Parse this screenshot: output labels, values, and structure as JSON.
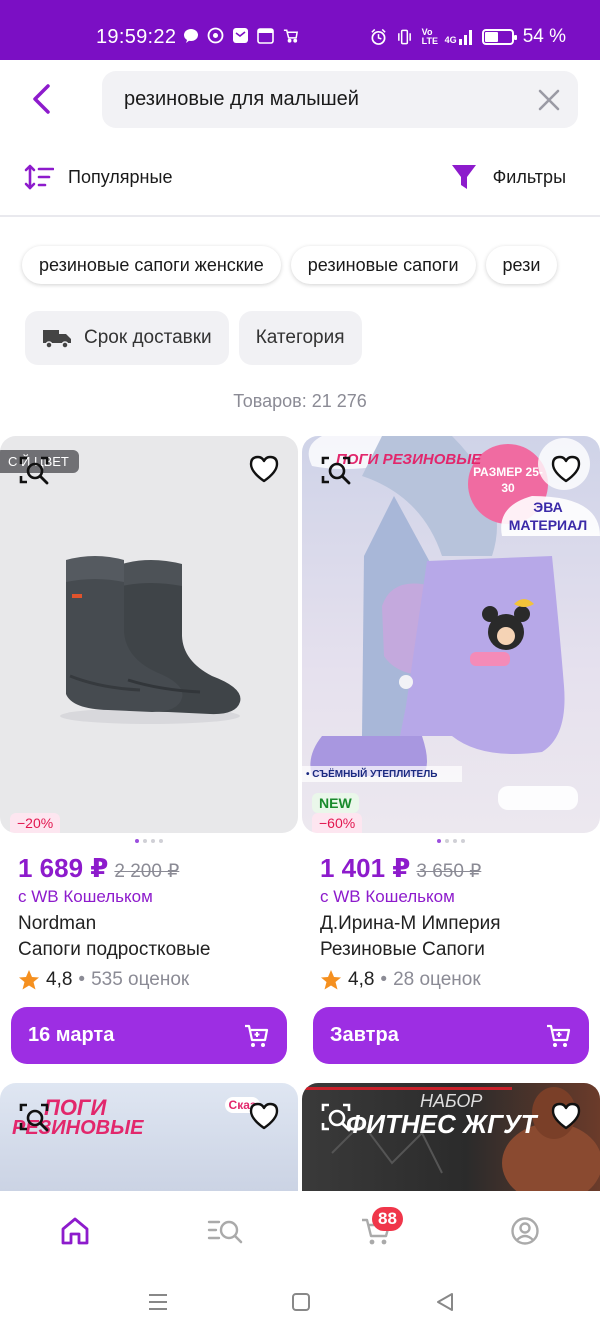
{
  "status_bar": {
    "time": "19:59:22",
    "battery_percent": "54 %",
    "battery_level": 0.54,
    "volte_label": "Vo LTE",
    "network_label": "4G",
    "bg_color": "#7b0fc4"
  },
  "search": {
    "query": "резиновые для малышей"
  },
  "sort": {
    "label": "Популярные"
  },
  "filters_button": {
    "label": "Фильтры"
  },
  "chips": [
    {
      "label": "резиновые сапоги женские"
    },
    {
      "label": "резиновые сапоги"
    },
    {
      "label": "рези"
    }
  ],
  "filter_buttons": {
    "delivery": "Срок доставки",
    "category": "Категория"
  },
  "product_count": "Товаров: 21 276",
  "products": [
    {
      "tag": "С  Й ЦВЕТ",
      "discount": "−20%",
      "price": "1 689 ₽",
      "old_price": "2 200 ₽",
      "wallet": "с WB Кошельком",
      "brand": "Nordman",
      "name": "Сапоги подростковые",
      "rating": "4,8",
      "reviews": "535 оценок",
      "delivery": "16 марта"
    },
    {
      "new_badge": "NEW",
      "discount": "−60%",
      "promo_size": "РАЗМЕР 25-30",
      "promo_material": "ЭВА МАТЕРИАЛ",
      "promo_title": "ПОГИ РЕЗИНОВЫЕ",
      "promo_bullet": "• СЪЁМНЫЙ УТЕПЛИТЕЛЬ",
      "price": "1 401 ₽",
      "old_price": "3 650 ₽",
      "wallet": "с WB Кошельком",
      "brand": "Д.Ирина-М Империя",
      "name": "Резиновые Сапоги",
      "rating": "4,8",
      "reviews": "28 оценок",
      "delivery": "Завтра"
    }
  ],
  "next_products": [
    {
      "title_a": "ПОГИ",
      "title_b": "РЕЗИНОВЫЕ",
      "logo": "Сказ"
    },
    {
      "title_a": "НАБОР",
      "title_b": "ФИТНЕС ЖГУТ"
    }
  ],
  "bottom_nav": {
    "cart_count": "88"
  },
  "colors": {
    "accent": "#9d2ee3",
    "price": "#8d1bcc",
    "discount": "#e2174f",
    "star": "#f5901f"
  }
}
